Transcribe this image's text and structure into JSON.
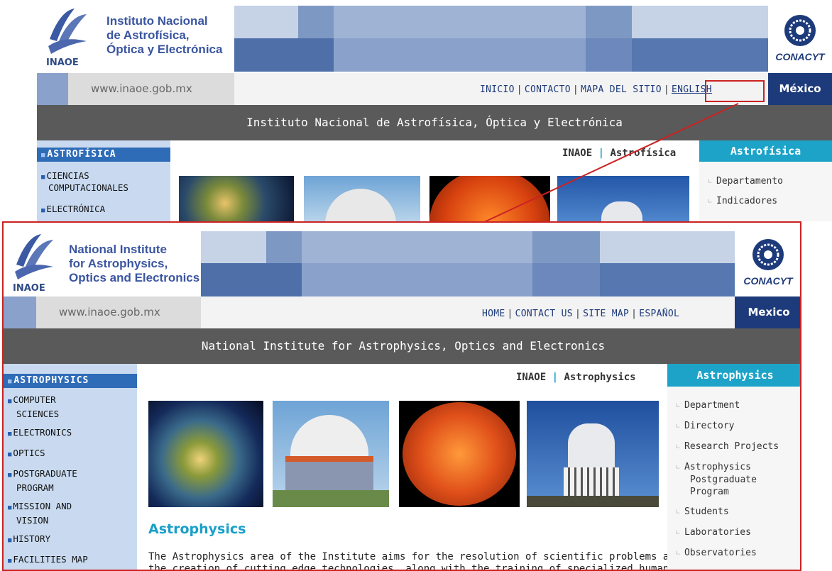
{
  "top": {
    "logo_text": "INAOE",
    "institute_lines": [
      "Instituto Nacional",
      "de Astrofísica,",
      "Óptica y Electrónica"
    ],
    "conacyt": "CONACYT",
    "url": "www.inaoe.gob.mx",
    "nav": [
      "INICIO",
      "CONTACTO",
      "MAPA DEL SITIO",
      "ENGLISH"
    ],
    "mexico": "México",
    "band_title": "Instituto Nacional de Astrofísica, Óptica y Electrónica",
    "left_active": "ASTROFÍSICA",
    "left_items": [
      "CIENCIAS",
      "COMPUTACIONALES",
      "ELECTRÓNICA"
    ],
    "crumb_home": "INAOE",
    "crumb_sep": "|",
    "crumb_page": "Astrofísica",
    "right_title": "Astrofísica",
    "right_items": [
      "Departamento",
      "Indicadores"
    ]
  },
  "bottom": {
    "logo_text": "INAOE",
    "institute_lines": [
      "National Institute",
      "for Astrophysics,",
      "Optics and Electronics"
    ],
    "conacyt": "CONACYT",
    "url": "www.inaoe.gob.mx",
    "nav": [
      "HOME",
      "CONTACT US",
      "SITE MAP",
      "ESPAÑOL"
    ],
    "mexico": "Mexico",
    "band_title": "National Institute for Astrophysics, Optics and Electronics",
    "left_active": "ASTROPHYSICS",
    "left_items": [
      {
        "lines": [
          "COMPUTER",
          "SCIENCES"
        ]
      },
      {
        "lines": [
          "ELECTRONICS"
        ]
      },
      {
        "lines": [
          "OPTICS"
        ]
      },
      {
        "lines": [
          "POSTGRADUATE",
          "PROGRAM"
        ]
      },
      {
        "lines": [
          "MISSION AND",
          "VISION"
        ]
      },
      {
        "lines": [
          "HISTORY"
        ]
      },
      {
        "lines": [
          "FACILITIES MAP"
        ]
      }
    ],
    "crumb_home": "INAOE",
    "crumb_sep": "|",
    "crumb_page": "Astrophysics",
    "right_title": "Astrophysics",
    "right_items": [
      {
        "lines": [
          "Department"
        ]
      },
      {
        "lines": [
          "Directory"
        ]
      },
      {
        "lines": [
          "Research Projects"
        ]
      },
      {
        "lines": [
          "Astrophysics",
          "Postgraduate",
          "Program"
        ]
      },
      {
        "lines": [
          "Students"
        ]
      },
      {
        "lines": [
          "Laboratories"
        ]
      },
      {
        "lines": [
          "Observatories"
        ]
      }
    ],
    "section_title": "Astrophysics",
    "paragraph_lines": [
      "The Astrophysics area of the Institute aims for the resolution of scientific problems and",
      "the creation of cutting edge technologies, along with the training of specialized human"
    ]
  },
  "colors": {
    "highlight": "#cc2222",
    "nav_blue": "#1d3a7a",
    "accent_cyan": "#1da3c8",
    "leftnav_bg": "#c9daf0",
    "mexico_bg": "#1d3a7a"
  }
}
